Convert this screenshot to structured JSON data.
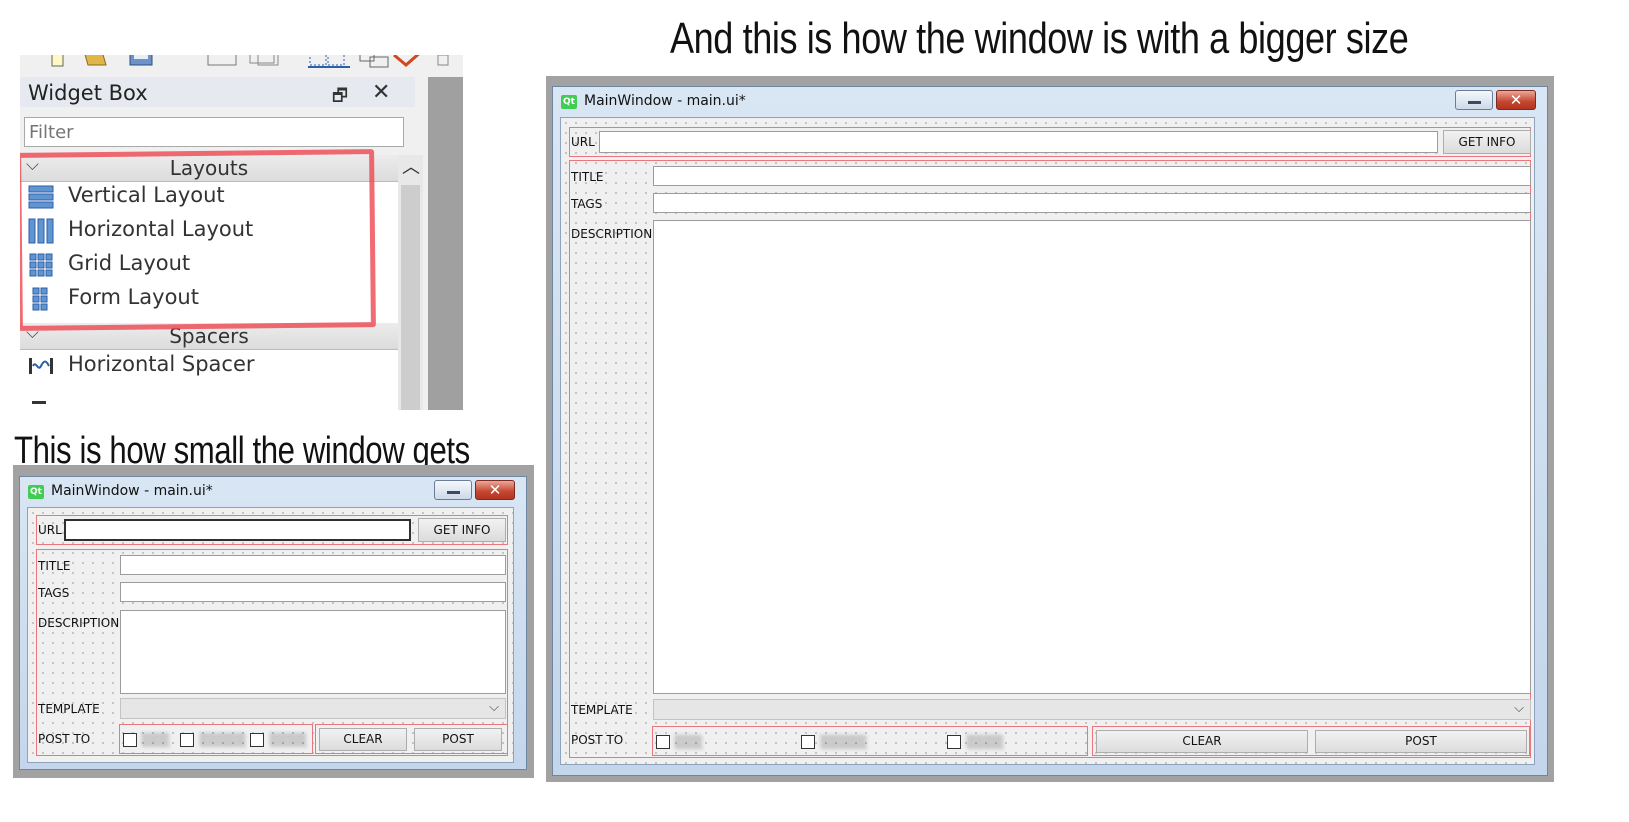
{
  "captions": {
    "big": "And this is how the window is with a bigger size",
    "small": "This is how small the window gets"
  },
  "widget_box": {
    "title": "Widget Box",
    "float_icon": "restore-icon",
    "close_icon": "close-icon",
    "filter_placeholder": "Filter",
    "categories": [
      {
        "label": "Layouts",
        "items": [
          {
            "label": "Vertical Layout",
            "icon": "vertical-layout-icon"
          },
          {
            "label": "Horizontal Layout",
            "icon": "horizontal-layout-icon"
          },
          {
            "label": "Grid Layout",
            "icon": "grid-layout-icon"
          },
          {
            "label": "Form Layout",
            "icon": "form-layout-icon"
          }
        ]
      },
      {
        "label": "Spacers",
        "items": [
          {
            "label": "Horizontal Spacer",
            "icon": "horizontal-spacer-icon"
          }
        ]
      }
    ]
  },
  "window": {
    "title": "MainWindow - main.ui*",
    "app_icon": "Qt",
    "close_glyph": "✕",
    "url_label": "URL",
    "get_info": "GET INFO",
    "title_label": "TITLE",
    "tags_label": "TAGS",
    "description_label": "DESCRIPTION",
    "template_label": "TEMPLATE",
    "template_arrow": "⌵",
    "post_to_label": "POST TO",
    "clear": "CLEAR",
    "post": "POST"
  },
  "colors": {
    "highlight_red": "#e8787e",
    "titlebar_blue": "#c4d6ec",
    "qt_green": "#41cd52"
  }
}
